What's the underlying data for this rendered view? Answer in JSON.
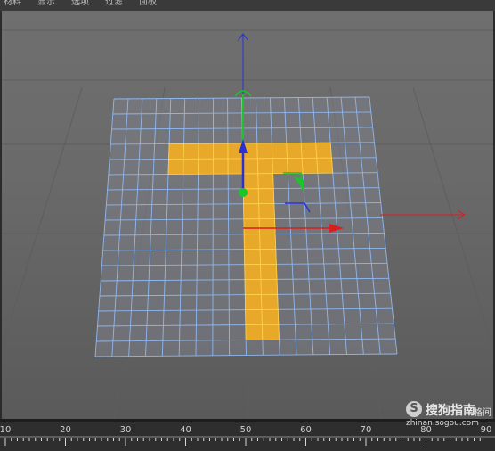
{
  "menu": {
    "items": [
      "材料",
      "显示",
      "选项",
      "过滤",
      "面板"
    ]
  },
  "viewport": {
    "plane_segments": {
      "cols": 18,
      "rows": 17
    },
    "selected_shape": "T",
    "colors": {
      "background": "#6d6d6d",
      "grid_floor": "#5e5e5e",
      "mesh_edge": "#8fb7ee",
      "selection_fill": "#e8a92a",
      "selection_edge": "#ffd24a",
      "axis_x": "#d81e1e",
      "axis_y": "#2a30d6",
      "axis_z": "#19c52a"
    },
    "icons": [
      "move-axis-x-icon",
      "move-axis-y-icon",
      "move-axis-z-icon",
      "rotation-handle-icon",
      "axis-center-icon"
    ]
  },
  "timeline": {
    "tick_labels": [
      "10",
      "20",
      "30",
      "40",
      "50",
      "60",
      "70",
      "80",
      "90"
    ]
  },
  "watermark": {
    "icon_letter": "S",
    "name": "搜狗指南",
    "extra": "格间",
    "url": "zhinan.sogou.com"
  }
}
